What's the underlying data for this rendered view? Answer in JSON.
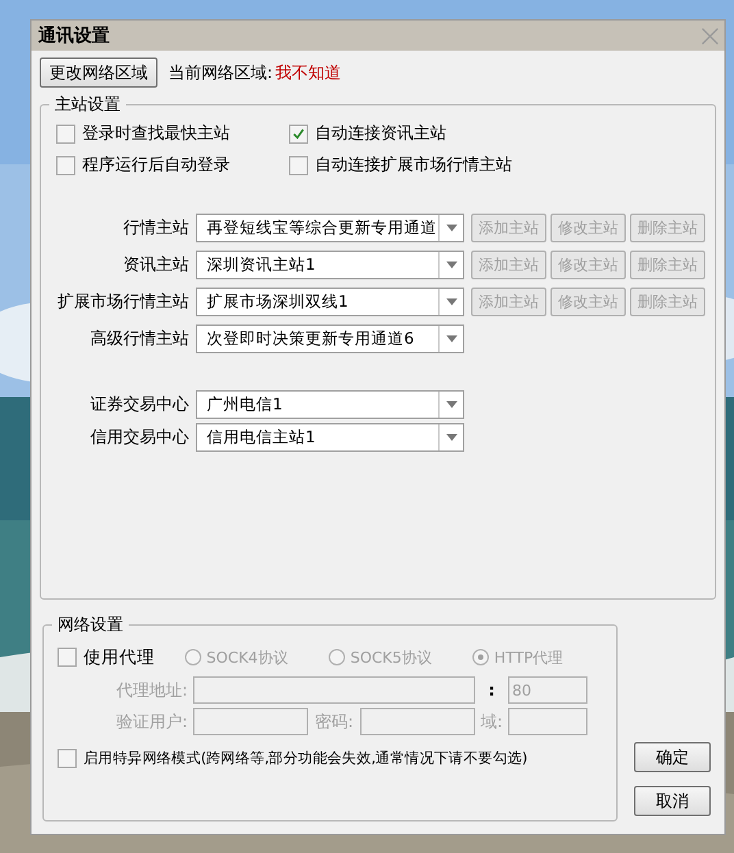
{
  "window": {
    "title": "通讯设置"
  },
  "region": {
    "button": "更改网络区域",
    "label": "当前网络区域:",
    "value": "我不知道"
  },
  "master_group": {
    "title": "主站设置",
    "options": [
      {
        "label": "登录时查找最快主站",
        "checked": false
      },
      {
        "label": "自动连接资讯主站",
        "checked": true
      },
      {
        "label": "程序运行后自动登录",
        "checked": false
      },
      {
        "label": "自动连接扩展市场行情主站",
        "checked": false
      }
    ],
    "servers": [
      {
        "label": "行情主站",
        "value": "再登短线宝等综合更新专用通道",
        "buttons": [
          {
            "label": "添加主站",
            "disabled": true
          },
          {
            "label": "修改主站",
            "disabled": true
          },
          {
            "label": "删除主站",
            "disabled": true
          }
        ]
      },
      {
        "label": "资讯主站",
        "value": "深圳资讯主站1",
        "buttons": [
          {
            "label": "添加主站",
            "disabled": true
          },
          {
            "label": "修改主站",
            "disabled": true
          },
          {
            "label": "删除主站",
            "disabled": true
          }
        ]
      },
      {
        "label": "扩展市场行情主站",
        "value": "扩展市场深圳双线1",
        "buttons": [
          {
            "label": "添加主站",
            "disabled": true
          },
          {
            "label": "修改主站",
            "disabled": true
          },
          {
            "label": "删除主站",
            "disabled": true
          }
        ]
      },
      {
        "label": "高级行情主站",
        "value": "次登即时决策更新专用通道6"
      }
    ],
    "trade_centers": [
      {
        "label": "证券交易中心",
        "value": "广州电信1"
      },
      {
        "label": "信用交易中心",
        "value": "信用电信主站1"
      }
    ]
  },
  "network_group": {
    "title": "网络设置",
    "use_proxy": {
      "label": "使用代理",
      "checked": false
    },
    "protocols": [
      {
        "label": "SOCK4协议",
        "selected": false
      },
      {
        "label": "SOCK5协议",
        "selected": false
      },
      {
        "label": "HTTP代理",
        "selected": true
      }
    ],
    "fields_disabled": true,
    "address_label": "代理地址:",
    "port_separator": ":",
    "port": "80",
    "user_label": "验证用户:",
    "password_label": "密码:",
    "domain_label": "域:",
    "special_mode": {
      "label": "启用特异网络模式(跨网络等,部分功能会失效,通常情况下请不要勾选)",
      "checked": false
    }
  },
  "buttons": [
    "确定",
    "取消"
  ]
}
